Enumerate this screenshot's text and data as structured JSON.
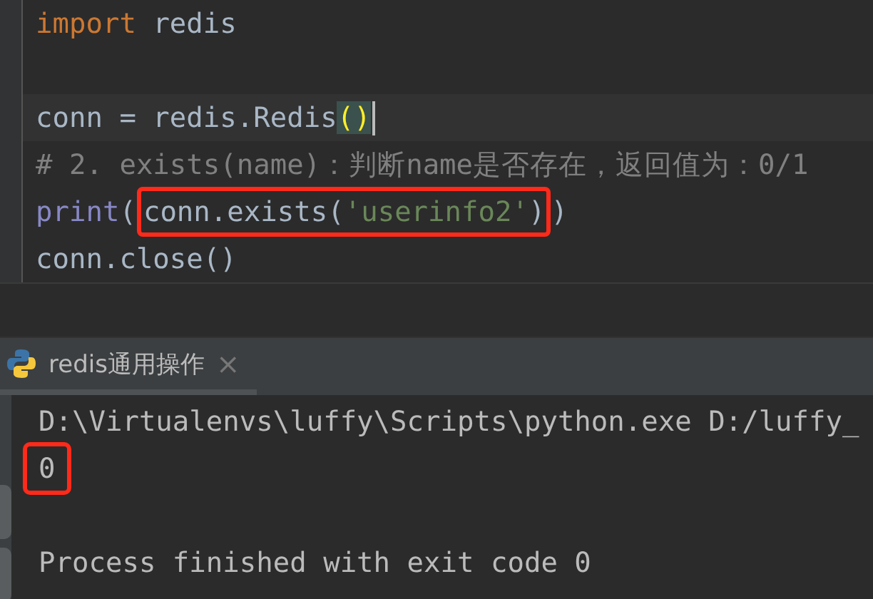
{
  "editor": {
    "lines": [
      {
        "kind": "code",
        "segments": [
          {
            "highlighted": false,
            "tokens": [
              {
                "kind": "keyword",
                "text": "import"
              },
              {
                "kind": "plain",
                "text": " redis"
              }
            ]
          }
        ]
      },
      {
        "kind": "blank"
      },
      {
        "kind": "current",
        "segments": [
          {
            "highlighted": false,
            "tokens": [
              {
                "kind": "plain",
                "text": "conn = redis.Redis"
              },
              {
                "kind": "bracket-match",
                "text": "()"
              }
            ]
          }
        ]
      },
      {
        "kind": "code",
        "segments": [
          {
            "highlighted": false,
            "tokens": [
              {
                "kind": "comment",
                "text": "# 2. exists(name)：判断name是否存在，返回值为：0/1"
              }
            ]
          }
        ]
      },
      {
        "kind": "code",
        "segments": [
          {
            "highlighted": false,
            "tokens": [
              {
                "kind": "builtin",
                "text": "print"
              },
              {
                "kind": "plain",
                "text": "("
              }
            ]
          },
          {
            "highlighted": true,
            "tokens": [
              {
                "kind": "plain",
                "text": "conn.exists("
              },
              {
                "kind": "string",
                "text": "'userinfo2'"
              },
              {
                "kind": "plain",
                "text": ")"
              }
            ]
          },
          {
            "highlighted": false,
            "tokens": [
              {
                "kind": "plain",
                "text": ")"
              }
            ]
          }
        ]
      },
      {
        "kind": "code",
        "segments": [
          {
            "highlighted": false,
            "tokens": [
              {
                "kind": "plain",
                "text": "conn.close()"
              }
            ]
          }
        ]
      }
    ]
  },
  "run_panel": {
    "tabs": [
      {
        "label": "redis通用操作",
        "selected": true,
        "close": "×"
      }
    ],
    "console": [
      {
        "kind": "output",
        "highlighted": false,
        "text": "D:\\Virtualenvs\\luffy\\Scripts\\python.exe D:/luffy_"
      },
      {
        "kind": "output",
        "highlighted": true,
        "text": "0"
      },
      {
        "kind": "exit",
        "highlighted": false,
        "text": "Process finished with exit code 0"
      }
    ]
  }
}
